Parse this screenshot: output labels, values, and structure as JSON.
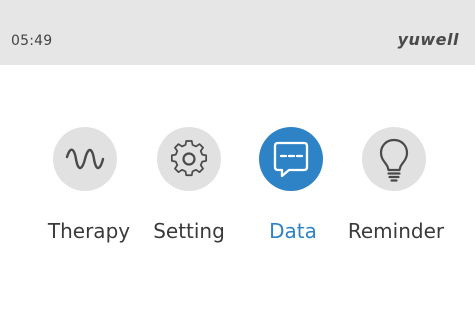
{
  "status_bar": {
    "time": "05:49",
    "brand": "yuwell"
  },
  "menu": {
    "items": [
      {
        "label": "Therapy",
        "icon": "wave-icon",
        "selected": false
      },
      {
        "label": "Setting",
        "icon": "gear-icon",
        "selected": false
      },
      {
        "label": "Data",
        "icon": "chat-bubble-icon",
        "selected": true
      },
      {
        "label": "Reminder",
        "icon": "lightbulb-icon",
        "selected": false
      }
    ]
  },
  "colors": {
    "status_bar_bg": "#e6e6e6",
    "icon_circle": "#e1e1e1",
    "accent": "#2e83c6",
    "text": "#3a3a3a"
  }
}
